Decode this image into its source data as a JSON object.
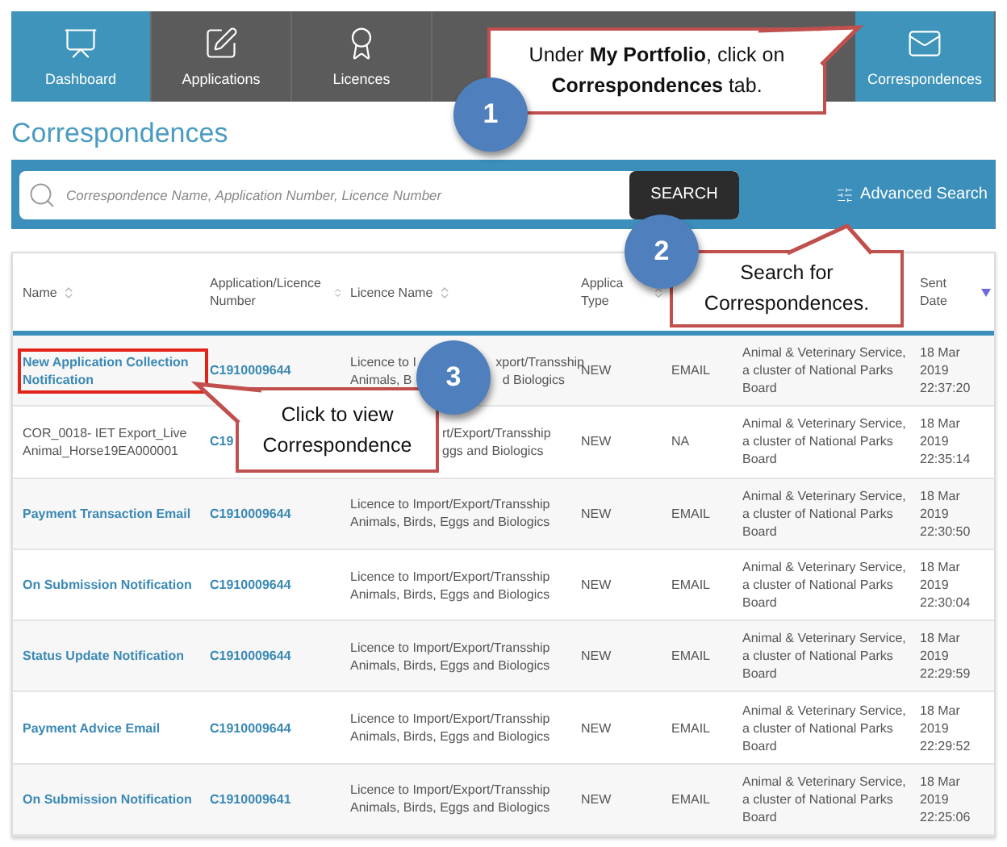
{
  "nav": {
    "tabs": [
      {
        "label": "Dashboard",
        "selected": true
      },
      {
        "label": "Applications",
        "selected": false
      },
      {
        "label": "Licences",
        "selected": false
      },
      {
        "label": "Correspondences",
        "selected": true
      }
    ]
  },
  "page_title": "Correspondences",
  "search": {
    "placeholder": "Correspondence Name, Application Number, Licence Number",
    "button": "SEARCH",
    "advanced": "Advanced Search"
  },
  "table": {
    "columns": [
      {
        "label": "Name",
        "sorted": false
      },
      {
        "label": "Application/Licence Number",
        "sorted": false
      },
      {
        "label": "Licence Name",
        "sorted": false
      },
      {
        "label": "Applica Type",
        "sorted": false
      },
      {
        "label": "Sent Date",
        "sorted": true
      }
    ],
    "rows": [
      {
        "name": "New Application Collection Notification",
        "link": true,
        "highlighted": true,
        "number": "C1910009644",
        "licence_parts": [
          [
            "Licence to I",
            "xport/Transship"
          ],
          [
            "Animals, B",
            "d Biologics"
          ]
        ],
        "type": "NEW",
        "channel": "EMAIL",
        "agency": "Animal & Veterinary Service, a cluster of National Parks Board",
        "date": "18 Mar 2019 22:37:20"
      },
      {
        "name": "COR_0018- IET Export_Live Animal_Horse19EA000001",
        "link": false,
        "highlighted": false,
        "number": "C19",
        "licence_parts": [
          [
            "rt/Export/Transship"
          ],
          [
            "ggs and Biologics"
          ]
        ],
        "type": "NEW",
        "channel": "NA",
        "agency": "Animal & Veterinary Service, a cluster of National Parks Board",
        "date": "18 Mar 2019 22:35:14"
      },
      {
        "name": "Payment Transaction Email",
        "link": true,
        "highlighted": false,
        "number": "C1910009644",
        "licence": "Licence to Import/Export/Transship Animals, Birds, Eggs and Biologics",
        "type": "NEW",
        "channel": "EMAIL",
        "agency": "Animal & Veterinary Service, a cluster of National Parks Board",
        "date": "18 Mar 2019 22:30:50"
      },
      {
        "name": "On Submission Notification",
        "link": true,
        "highlighted": false,
        "number": "C1910009644",
        "licence": "Licence to Import/Export/Transship Animals, Birds, Eggs and Biologics",
        "type": "NEW",
        "channel": "EMAIL",
        "agency": "Animal & Veterinary Service, a cluster of National Parks Board",
        "date": "18 Mar 2019 22:30:04"
      },
      {
        "name": "Status Update Notification",
        "link": true,
        "highlighted": false,
        "number": "C1910009644",
        "licence": "Licence to Import/Export/Transship Animals, Birds, Eggs and Biologics",
        "type": "NEW",
        "channel": "EMAIL",
        "agency": "Animal & Veterinary Service, a cluster of National Parks Board",
        "date": "18 Mar 2019 22:29:59"
      },
      {
        "name": "Payment Advice Email",
        "link": true,
        "highlighted": false,
        "number": "C1910009644",
        "licence": "Licence to Import/Export/Transship Animals, Birds, Eggs and Biologics",
        "type": "NEW",
        "channel": "EMAIL",
        "agency": "Animal & Veterinary Service, a cluster of National Parks Board",
        "date": "18 Mar 2019 22:29:52"
      },
      {
        "name": "On Submission Notification",
        "link": true,
        "highlighted": false,
        "number": "C1910009641",
        "licence": "Licence to Import/Export/Transship Animals, Birds, Eggs and Biologics",
        "type": "NEW",
        "channel": "EMAIL",
        "agency": "Animal & Veterinary Service, a cluster of National Parks Board",
        "date": "18 Mar 2019 22:25:06"
      }
    ]
  },
  "callouts": [
    {
      "number": "1",
      "text": "Under **My Portfolio**, click on **Correspondences** tab."
    },
    {
      "number": "2",
      "text": "Search for Correspondences."
    },
    {
      "number": "3",
      "text": "Click to view Correspondence"
    }
  ]
}
